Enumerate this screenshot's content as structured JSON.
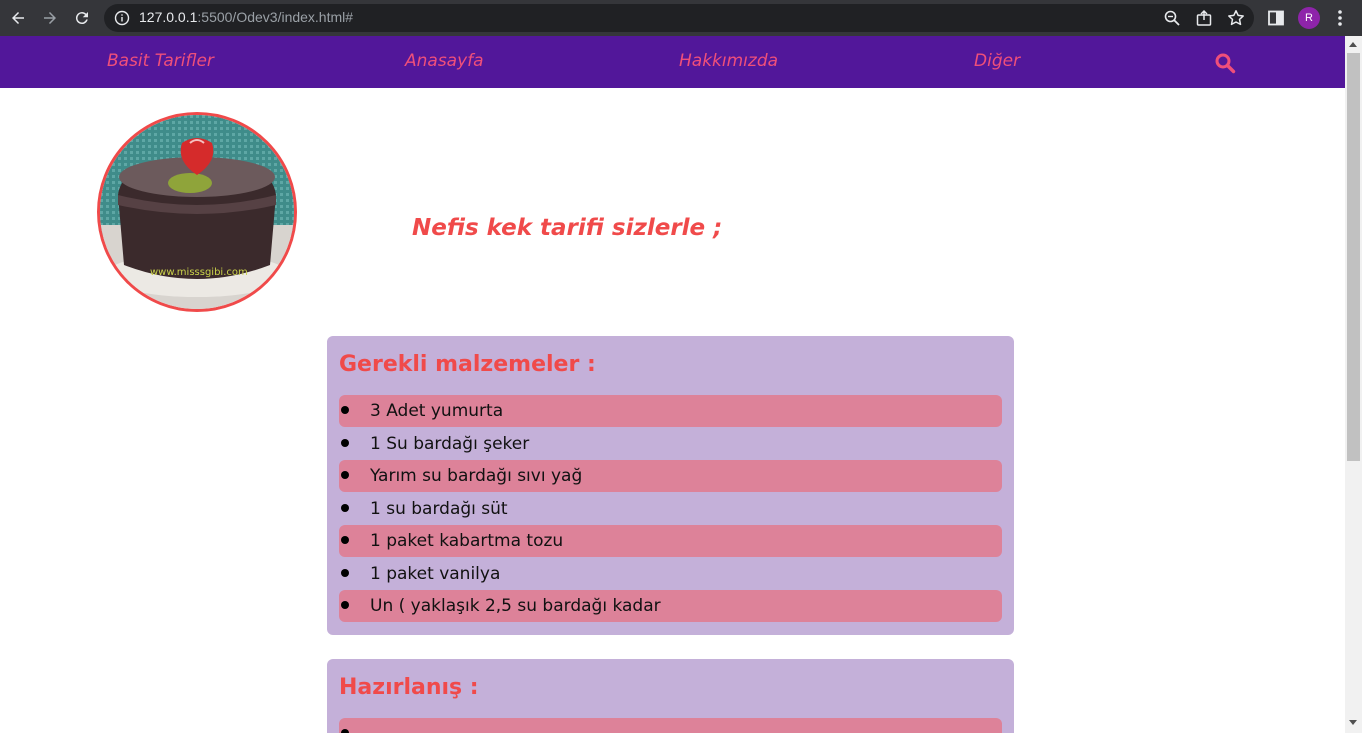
{
  "browser": {
    "url_host": "127.0.0.1",
    "url_rest": ":5500/Odev3/index.html#",
    "profile_initial": "R"
  },
  "navbar": {
    "brand": "Basit Tarifler",
    "links": [
      "Anasayfa",
      "Hakkımızda",
      "Diğer"
    ],
    "search_icon": "search-icon"
  },
  "hero": {
    "headline": "Nefis kek tarifi sizlerle ;",
    "photo_watermark": "www.misssgibi.com"
  },
  "ingredients": {
    "title": "Gerekli malzemeler :",
    "items": [
      "3 Adet yumurta",
      "1 Su bardağı şeker",
      "Yarım su bardağı sıvı yağ",
      "1 su bardağı süt",
      "1 paket kabartma tozu",
      "1 paket vanilya",
      "Un ( yaklaşık 2,5 su bardağı kadar"
    ]
  },
  "preparation": {
    "title": "Hazırlanış :"
  },
  "colors": {
    "navbar_bg": "#52179a",
    "accent": "#f04a4a",
    "nav_link": "#ef4f7a",
    "card_bg": "#c4b0d9",
    "row_highlight": "#dd8299"
  }
}
